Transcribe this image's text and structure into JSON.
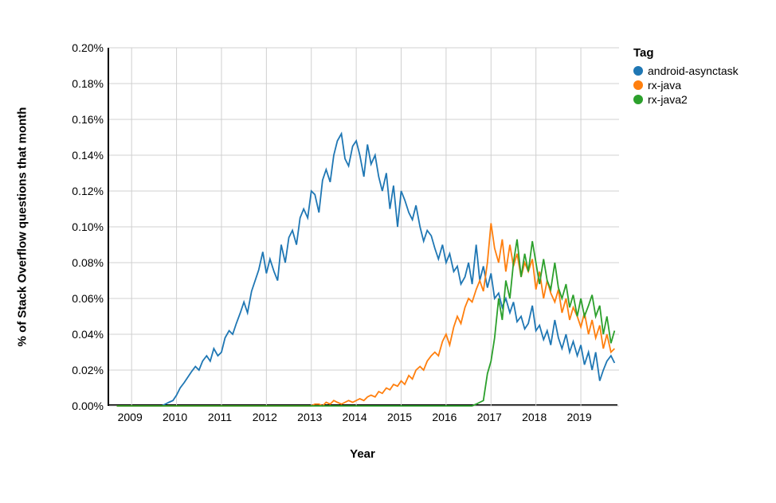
{
  "chart_data": {
    "type": "line",
    "title": "",
    "xlabel": "Year",
    "ylabel": "% of Stack Overflow questions that month",
    "x_start": 2008.5,
    "x_end": 2019.85,
    "x_ticks": [
      2009,
      2010,
      2011,
      2012,
      2013,
      2014,
      2015,
      2016,
      2017,
      2018,
      2019
    ],
    "y_start": 0.0,
    "y_end": 0.2,
    "y_ticks": [
      0.0,
      0.02,
      0.04,
      0.06,
      0.08,
      0.1,
      0.12,
      0.14,
      0.16,
      0.18,
      0.2
    ],
    "y_tick_labels": [
      "0.00%",
      "0.02%",
      "0.04%",
      "0.06%",
      "0.08%",
      "0.10%",
      "0.12%",
      "0.14%",
      "0.16%",
      "0.18%",
      "0.20%"
    ],
    "legend_title": "Tag",
    "series": [
      {
        "name": "android-asynctask",
        "color": "#1f77b4",
        "x": [
          2008.67,
          2008.75,
          2008.83,
          2008.92,
          2009.0,
          2009.08,
          2009.17,
          2009.25,
          2009.33,
          2009.42,
          2009.5,
          2009.58,
          2009.67,
          2009.75,
          2009.83,
          2009.92,
          2010.0,
          2010.08,
          2010.17,
          2010.25,
          2010.33,
          2010.42,
          2010.5,
          2010.58,
          2010.67,
          2010.75,
          2010.83,
          2010.92,
          2011.0,
          2011.08,
          2011.17,
          2011.25,
          2011.33,
          2011.42,
          2011.5,
          2011.58,
          2011.67,
          2011.75,
          2011.83,
          2011.92,
          2012.0,
          2012.08,
          2012.17,
          2012.25,
          2012.33,
          2012.42,
          2012.5,
          2012.58,
          2012.67,
          2012.75,
          2012.83,
          2012.92,
          2013.0,
          2013.08,
          2013.17,
          2013.25,
          2013.33,
          2013.42,
          2013.5,
          2013.58,
          2013.67,
          2013.75,
          2013.83,
          2013.92,
          2014.0,
          2014.08,
          2014.17,
          2014.25,
          2014.33,
          2014.42,
          2014.5,
          2014.58,
          2014.67,
          2014.75,
          2014.83,
          2014.92,
          2015.0,
          2015.08,
          2015.17,
          2015.25,
          2015.33,
          2015.42,
          2015.5,
          2015.58,
          2015.67,
          2015.75,
          2015.83,
          2015.92,
          2016.0,
          2016.08,
          2016.17,
          2016.25,
          2016.33,
          2016.42,
          2016.5,
          2016.58,
          2016.67,
          2016.75,
          2016.83,
          2016.92,
          2017.0,
          2017.08,
          2017.17,
          2017.25,
          2017.33,
          2017.42,
          2017.5,
          2017.58,
          2017.67,
          2017.75,
          2017.83,
          2017.92,
          2018.0,
          2018.08,
          2018.17,
          2018.25,
          2018.33,
          2018.42,
          2018.5,
          2018.58,
          2018.67,
          2018.75,
          2018.83,
          2018.92,
          2019.0,
          2019.08,
          2019.17,
          2019.25,
          2019.33,
          2019.42,
          2019.5,
          2019.58,
          2019.67,
          2019.75
        ],
        "values": [
          0,
          0,
          0,
          0,
          0,
          0,
          0,
          0,
          0,
          0,
          0,
          0,
          0,
          0.001,
          0.002,
          0.003,
          0.006,
          0.01,
          0.013,
          0.016,
          0.019,
          0.022,
          0.02,
          0.025,
          0.028,
          0.025,
          0.032,
          0.028,
          0.03,
          0.038,
          0.042,
          0.04,
          0.046,
          0.052,
          0.058,
          0.052,
          0.064,
          0.07,
          0.076,
          0.086,
          0.074,
          0.082,
          0.075,
          0.07,
          0.09,
          0.08,
          0.094,
          0.098,
          0.09,
          0.105,
          0.11,
          0.105,
          0.12,
          0.118,
          0.108,
          0.126,
          0.132,
          0.125,
          0.14,
          0.148,
          0.152,
          0.138,
          0.134,
          0.145,
          0.148,
          0.14,
          0.128,
          0.146,
          0.135,
          0.14,
          0.128,
          0.12,
          0.13,
          0.11,
          0.123,
          0.1,
          0.12,
          0.115,
          0.108,
          0.104,
          0.112,
          0.1,
          0.092,
          0.098,
          0.095,
          0.088,
          0.082,
          0.09,
          0.08,
          0.085,
          0.075,
          0.078,
          0.068,
          0.072,
          0.08,
          0.068,
          0.09,
          0.07,
          0.078,
          0.066,
          0.074,
          0.06,
          0.063,
          0.055,
          0.06,
          0.052,
          0.058,
          0.047,
          0.05,
          0.043,
          0.046,
          0.056,
          0.042,
          0.045,
          0.037,
          0.042,
          0.034,
          0.048,
          0.038,
          0.032,
          0.04,
          0.03,
          0.036,
          0.028,
          0.034,
          0.023,
          0.03,
          0.02,
          0.03,
          0.014,
          0.02,
          0.025,
          0.028,
          0.024
        ]
      },
      {
        "name": "rx-java",
        "color": "#ff7f0e",
        "x": [
          2008.67,
          2008.75,
          2008.83,
          2008.92,
          2009.0,
          2009.08,
          2009.17,
          2009.25,
          2009.33,
          2009.42,
          2009.5,
          2009.58,
          2009.67,
          2009.75,
          2009.83,
          2009.92,
          2010.0,
          2010.08,
          2010.17,
          2010.25,
          2010.33,
          2010.42,
          2010.5,
          2010.58,
          2010.67,
          2010.75,
          2010.83,
          2010.92,
          2011.0,
          2011.08,
          2011.17,
          2011.25,
          2011.33,
          2011.42,
          2011.5,
          2011.58,
          2011.67,
          2011.75,
          2011.83,
          2011.92,
          2012.0,
          2012.08,
          2012.17,
          2012.25,
          2012.33,
          2012.42,
          2012.5,
          2012.58,
          2012.67,
          2012.75,
          2012.83,
          2012.92,
          2013.0,
          2013.08,
          2013.17,
          2013.25,
          2013.33,
          2013.42,
          2013.5,
          2013.58,
          2013.67,
          2013.75,
          2013.83,
          2013.92,
          2014.0,
          2014.08,
          2014.17,
          2014.25,
          2014.33,
          2014.42,
          2014.5,
          2014.58,
          2014.67,
          2014.75,
          2014.83,
          2014.92,
          2015.0,
          2015.08,
          2015.17,
          2015.25,
          2015.33,
          2015.42,
          2015.5,
          2015.58,
          2015.67,
          2015.75,
          2015.83,
          2015.92,
          2016.0,
          2016.08,
          2016.17,
          2016.25,
          2016.33,
          2016.42,
          2016.5,
          2016.58,
          2016.67,
          2016.75,
          2016.83,
          2016.92,
          2017.0,
          2017.08,
          2017.17,
          2017.25,
          2017.33,
          2017.42,
          2017.5,
          2017.58,
          2017.67,
          2017.75,
          2017.83,
          2017.92,
          2018.0,
          2018.08,
          2018.17,
          2018.25,
          2018.33,
          2018.42,
          2018.5,
          2018.58,
          2018.67,
          2018.75,
          2018.83,
          2018.92,
          2019.0,
          2019.08,
          2019.17,
          2019.25,
          2019.33,
          2019.42,
          2019.5,
          2019.58,
          2019.67,
          2019.75
        ],
        "values": [
          0,
          0,
          0,
          0,
          0,
          0,
          0,
          0,
          0,
          0,
          0,
          0,
          0,
          0,
          0,
          0,
          0,
          0,
          0,
          0,
          0,
          0,
          0,
          0,
          0,
          0,
          0,
          0,
          0,
          0,
          0,
          0,
          0,
          0,
          0,
          0,
          0,
          0,
          0,
          0,
          0,
          0,
          0,
          0,
          0,
          0,
          0,
          0,
          0,
          0,
          0,
          0,
          0,
          0.001,
          0.001,
          0,
          0.002,
          0.001,
          0.003,
          0.002,
          0.001,
          0.002,
          0.003,
          0.002,
          0.003,
          0.004,
          0.003,
          0.005,
          0.006,
          0.005,
          0.008,
          0.007,
          0.01,
          0.009,
          0.012,
          0.011,
          0.014,
          0.012,
          0.017,
          0.015,
          0.02,
          0.022,
          0.02,
          0.025,
          0.028,
          0.03,
          0.028,
          0.036,
          0.04,
          0.034,
          0.044,
          0.05,
          0.046,
          0.055,
          0.06,
          0.058,
          0.065,
          0.07,
          0.064,
          0.08,
          0.102,
          0.088,
          0.08,
          0.093,
          0.075,
          0.09,
          0.078,
          0.085,
          0.072,
          0.08,
          0.075,
          0.082,
          0.065,
          0.075,
          0.06,
          0.07,
          0.063,
          0.058,
          0.065,
          0.052,
          0.06,
          0.048,
          0.055,
          0.05,
          0.044,
          0.052,
          0.04,
          0.048,
          0.038,
          0.045,
          0.032,
          0.04,
          0.03,
          0.032
        ]
      },
      {
        "name": "rx-java2",
        "color": "#2ca02c",
        "x": [
          2008.67,
          2008.75,
          2008.83,
          2008.92,
          2009.0,
          2009.08,
          2009.17,
          2009.25,
          2009.33,
          2009.42,
          2009.5,
          2009.58,
          2009.67,
          2009.75,
          2009.83,
          2009.92,
          2010.0,
          2010.08,
          2010.17,
          2010.25,
          2010.33,
          2010.42,
          2010.5,
          2010.58,
          2010.67,
          2010.75,
          2010.83,
          2010.92,
          2011.0,
          2011.08,
          2011.17,
          2011.25,
          2011.33,
          2011.42,
          2011.5,
          2011.58,
          2011.67,
          2011.75,
          2011.83,
          2011.92,
          2012.0,
          2012.08,
          2012.17,
          2012.25,
          2012.33,
          2012.42,
          2012.5,
          2012.58,
          2012.67,
          2012.75,
          2012.83,
          2012.92,
          2013.0,
          2013.08,
          2013.17,
          2013.25,
          2013.33,
          2013.42,
          2013.5,
          2013.58,
          2013.67,
          2013.75,
          2013.83,
          2013.92,
          2014.0,
          2014.08,
          2014.17,
          2014.25,
          2014.33,
          2014.42,
          2014.5,
          2014.58,
          2014.67,
          2014.75,
          2014.83,
          2014.92,
          2015.0,
          2015.08,
          2015.17,
          2015.25,
          2015.33,
          2015.42,
          2015.5,
          2015.58,
          2015.67,
          2015.75,
          2015.83,
          2015.92,
          2016.0,
          2016.08,
          2016.17,
          2016.25,
          2016.33,
          2016.42,
          2016.5,
          2016.58,
          2016.67,
          2016.75,
          2016.83,
          2016.92,
          2017.0,
          2017.08,
          2017.17,
          2017.25,
          2017.33,
          2017.42,
          2017.5,
          2017.58,
          2017.67,
          2017.75,
          2017.83,
          2017.92,
          2018.0,
          2018.08,
          2018.17,
          2018.25,
          2018.33,
          2018.42,
          2018.5,
          2018.58,
          2018.67,
          2018.75,
          2018.83,
          2018.92,
          2019.0,
          2019.08,
          2019.17,
          2019.25,
          2019.33,
          2019.42,
          2019.5,
          2019.58,
          2019.67,
          2019.75
        ],
        "values": [
          0,
          0,
          0,
          0,
          0,
          0,
          0,
          0,
          0,
          0,
          0,
          0,
          0,
          0,
          0,
          0,
          0,
          0,
          0,
          0,
          0,
          0,
          0,
          0,
          0,
          0,
          0,
          0,
          0,
          0,
          0,
          0,
          0,
          0,
          0,
          0,
          0,
          0,
          0,
          0,
          0,
          0,
          0,
          0,
          0,
          0,
          0,
          0,
          0,
          0,
          0,
          0,
          0,
          0,
          0,
          0,
          0,
          0,
          0,
          0,
          0,
          0,
          0,
          0,
          0,
          0,
          0,
          0,
          0,
          0,
          0,
          0,
          0,
          0,
          0,
          0,
          0,
          0,
          0,
          0,
          0,
          0,
          0,
          0,
          0,
          0,
          0,
          0,
          0,
          0,
          0,
          0,
          0,
          0,
          0,
          0,
          0.001,
          0.002,
          0.003,
          0.018,
          0.025,
          0.038,
          0.06,
          0.048,
          0.07,
          0.06,
          0.08,
          0.093,
          0.072,
          0.085,
          0.075,
          0.092,
          0.08,
          0.068,
          0.082,
          0.07,
          0.065,
          0.08,
          0.066,
          0.06,
          0.068,
          0.055,
          0.062,
          0.05,
          0.06,
          0.05,
          0.056,
          0.062,
          0.05,
          0.056,
          0.04,
          0.05,
          0.035,
          0.042
        ]
      }
    ]
  }
}
